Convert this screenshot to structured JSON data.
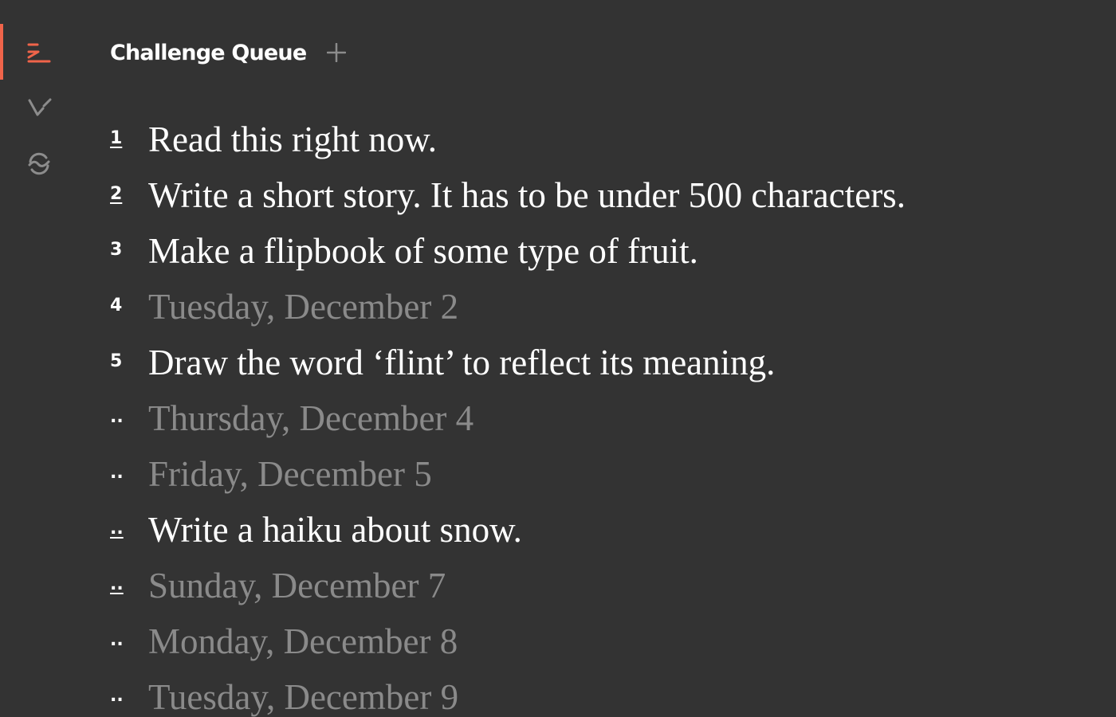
{
  "colors": {
    "background": "#333333",
    "accent": "#f0644a",
    "text_primary": "#ffffff",
    "text_muted": "#8a8a8a",
    "icon_muted": "#8c8c8c"
  },
  "sidebar": {
    "items": [
      {
        "name": "queue",
        "icon": "queue-icon",
        "active": true
      },
      {
        "name": "done",
        "icon": "check-icon",
        "active": false
      },
      {
        "name": "sync",
        "icon": "sync-icon",
        "active": false
      }
    ]
  },
  "header": {
    "title": "Challenge Queue",
    "add_icon": "plus-icon"
  },
  "queue": {
    "items": [
      {
        "marker": "1",
        "text": "Read this right now.",
        "placeholder": false,
        "underlined": true
      },
      {
        "marker": "2",
        "text": "Write a short story. It has to be under 500 characters.",
        "placeholder": false,
        "underlined": true
      },
      {
        "marker": "3",
        "text": "Make a flipbook of some type of fruit.",
        "placeholder": false,
        "underlined": false
      },
      {
        "marker": "4",
        "text": "Tuesday, December 2",
        "placeholder": true,
        "underlined": false
      },
      {
        "marker": "5",
        "text": "Draw the word ‘flint’ to reflect its meaning.",
        "placeholder": false,
        "underlined": false
      },
      {
        "marker": "..",
        "text": "Thursday, December 4",
        "placeholder": true,
        "underlined": false
      },
      {
        "marker": "..",
        "text": "Friday, December 5",
        "placeholder": true,
        "underlined": false
      },
      {
        "marker": "..",
        "text": "Write a haiku about snow.",
        "placeholder": false,
        "underlined": true
      },
      {
        "marker": "..",
        "text": "Sunday, December 7",
        "placeholder": true,
        "underlined": true
      },
      {
        "marker": "..",
        "text": "Monday, December 8",
        "placeholder": true,
        "underlined": false
      },
      {
        "marker": "..",
        "text": "Tuesday, December 9",
        "placeholder": true,
        "underlined": false
      }
    ]
  }
}
